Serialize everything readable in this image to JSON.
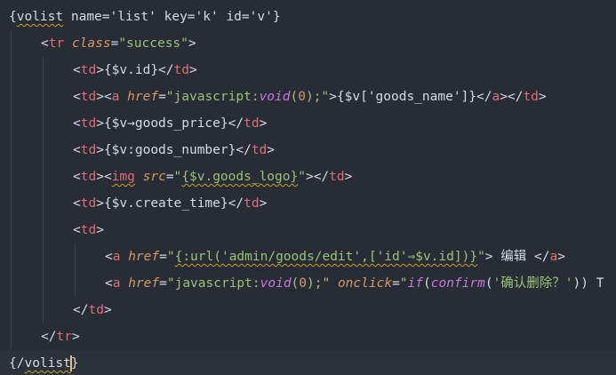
{
  "editor": {
    "colors": {
      "background": "#282c34",
      "current_line": "#2c313a",
      "tag": "#e06c75",
      "attribute": "#d19a66",
      "string": "#98c379",
      "function": "#c678dd",
      "text": "#d7dae0",
      "squiggle": "#c9a227"
    },
    "lines": [
      {
        "indent": 0,
        "tokens": [
          {
            "t": "{",
            "c": "punct"
          },
          {
            "t": "volist",
            "c": "text",
            "sq": true
          },
          {
            "t": " name='list' key='k' id='v'}",
            "c": "text"
          }
        ]
      },
      {
        "indent": 1,
        "tokens": [
          {
            "t": "<",
            "c": "punct"
          },
          {
            "t": "tr",
            "c": "tag"
          },
          {
            "t": " ",
            "c": "text"
          },
          {
            "t": "class",
            "c": "attr"
          },
          {
            "t": "=",
            "c": "punct"
          },
          {
            "t": "\"success\"",
            "c": "string"
          },
          {
            "t": ">",
            "c": "punct"
          }
        ]
      },
      {
        "indent": 2,
        "tokens": [
          {
            "t": "<",
            "c": "punct"
          },
          {
            "t": "td",
            "c": "tag"
          },
          {
            "t": ">",
            "c": "punct"
          },
          {
            "t": "{$v.id}",
            "c": "text"
          },
          {
            "t": "</",
            "c": "punct"
          },
          {
            "t": "td",
            "c": "tag"
          },
          {
            "t": ">",
            "c": "punct"
          }
        ]
      },
      {
        "indent": 2,
        "tokens": [
          {
            "t": "<",
            "c": "punct"
          },
          {
            "t": "td",
            "c": "tag"
          },
          {
            "t": ">",
            "c": "punct"
          },
          {
            "t": "<",
            "c": "punct"
          },
          {
            "t": "a",
            "c": "tag"
          },
          {
            "t": " ",
            "c": "text"
          },
          {
            "t": "href",
            "c": "attr"
          },
          {
            "t": "=",
            "c": "punct"
          },
          {
            "t": "\"javascript:",
            "c": "string"
          },
          {
            "t": "void",
            "c": "func"
          },
          {
            "t": "(",
            "c": "string"
          },
          {
            "t": "0",
            "c": "num"
          },
          {
            "t": ");\"",
            "c": "string"
          },
          {
            "t": ">",
            "c": "punct"
          },
          {
            "t": "{$v['goods_name']}",
            "c": "text"
          },
          {
            "t": "</",
            "c": "punct"
          },
          {
            "t": "a",
            "c": "tag"
          },
          {
            "t": ">",
            "c": "punct"
          },
          {
            "t": "</",
            "c": "punct"
          },
          {
            "t": "td",
            "c": "tag"
          },
          {
            "t": ">",
            "c": "punct"
          }
        ]
      },
      {
        "indent": 2,
        "tokens": [
          {
            "t": "<",
            "c": "punct"
          },
          {
            "t": "td",
            "c": "tag"
          },
          {
            "t": ">",
            "c": "punct"
          },
          {
            "t": "{$v→goods_price}",
            "c": "text"
          },
          {
            "t": "</",
            "c": "punct"
          },
          {
            "t": "td",
            "c": "tag"
          },
          {
            "t": ">",
            "c": "punct"
          }
        ]
      },
      {
        "indent": 2,
        "tokens": [
          {
            "t": "<",
            "c": "punct"
          },
          {
            "t": "td",
            "c": "tag"
          },
          {
            "t": ">",
            "c": "punct"
          },
          {
            "t": "{$v:goods_number}",
            "c": "text"
          },
          {
            "t": "</",
            "c": "punct"
          },
          {
            "t": "td",
            "c": "tag"
          },
          {
            "t": ">",
            "c": "punct"
          }
        ]
      },
      {
        "indent": 2,
        "tokens": [
          {
            "t": "<",
            "c": "punct"
          },
          {
            "t": "td",
            "c": "tag"
          },
          {
            "t": ">",
            "c": "punct"
          },
          {
            "t": "<",
            "c": "punct"
          },
          {
            "t": "img",
            "c": "tag",
            "sq": true
          },
          {
            "t": " ",
            "c": "text"
          },
          {
            "t": "src",
            "c": "attr"
          },
          {
            "t": "=",
            "c": "punct"
          },
          {
            "t": "\"",
            "c": "string"
          },
          {
            "t": "{$v.goods_logo}",
            "c": "string",
            "sq": true
          },
          {
            "t": "\"",
            "c": "string"
          },
          {
            "t": ">",
            "c": "punct"
          },
          {
            "t": "</",
            "c": "punct"
          },
          {
            "t": "td",
            "c": "tag"
          },
          {
            "t": ">",
            "c": "punct"
          }
        ]
      },
      {
        "indent": 2,
        "tokens": [
          {
            "t": "<",
            "c": "punct"
          },
          {
            "t": "td",
            "c": "tag"
          },
          {
            "t": ">",
            "c": "punct"
          },
          {
            "t": "{$v.create_time}",
            "c": "text"
          },
          {
            "t": "</",
            "c": "punct"
          },
          {
            "t": "td",
            "c": "tag"
          },
          {
            "t": ">",
            "c": "punct"
          }
        ]
      },
      {
        "indent": 2,
        "tokens": [
          {
            "t": "<",
            "c": "punct"
          },
          {
            "t": "td",
            "c": "tag"
          },
          {
            "t": ">",
            "c": "punct"
          }
        ]
      },
      {
        "indent": 3,
        "tokens": [
          {
            "t": "<",
            "c": "punct"
          },
          {
            "t": "a",
            "c": "tag"
          },
          {
            "t": " ",
            "c": "text"
          },
          {
            "t": "href",
            "c": "attr"
          },
          {
            "t": "=",
            "c": "punct"
          },
          {
            "t": "\"",
            "c": "string"
          },
          {
            "t": "{:url('admin/goods/edit',['id'⇒$v.id])}",
            "c": "string",
            "sq": true
          },
          {
            "t": "\"",
            "c": "string"
          },
          {
            "t": ">",
            "c": "punct"
          },
          {
            "t": " 编辑 ",
            "c": "text"
          },
          {
            "t": "</",
            "c": "punct"
          },
          {
            "t": "a",
            "c": "tag"
          },
          {
            "t": ">",
            "c": "punct"
          }
        ]
      },
      {
        "indent": 3,
        "tokens": [
          {
            "t": "<",
            "c": "punct"
          },
          {
            "t": "a",
            "c": "tag"
          },
          {
            "t": " ",
            "c": "text"
          },
          {
            "t": "href",
            "c": "attr"
          },
          {
            "t": "=",
            "c": "punct"
          },
          {
            "t": "\"javascript:",
            "c": "string"
          },
          {
            "t": "void",
            "c": "func"
          },
          {
            "t": "(",
            "c": "string"
          },
          {
            "t": "0",
            "c": "num"
          },
          {
            "t": ");\"",
            "c": "string"
          },
          {
            "t": " ",
            "c": "text"
          },
          {
            "t": "onclick",
            "c": "attr"
          },
          {
            "t": "=",
            "c": "punct"
          },
          {
            "t": "\"",
            "c": "string"
          },
          {
            "t": "if",
            "c": "func"
          },
          {
            "t": "(",
            "c": "punct"
          },
          {
            "t": "confirm",
            "c": "func"
          },
          {
            "t": "(",
            "c": "punct"
          },
          {
            "t": "'确认删除？'",
            "c": "string"
          },
          {
            "t": ")) T",
            "c": "text"
          }
        ]
      },
      {
        "indent": 2,
        "tokens": [
          {
            "t": "</",
            "c": "punct"
          },
          {
            "t": "td",
            "c": "tag"
          },
          {
            "t": ">",
            "c": "punct"
          }
        ]
      },
      {
        "indent": 1,
        "tokens": [
          {
            "t": "</",
            "c": "punct"
          },
          {
            "t": "tr",
            "c": "tag"
          },
          {
            "t": ">",
            "c": "punct"
          }
        ]
      },
      {
        "indent": 0,
        "current": true,
        "tokens": [
          {
            "t": "{/",
            "c": "punct"
          },
          {
            "t": "volist",
            "c": "text",
            "sq": true
          },
          {
            "t": "|",
            "c": "caret"
          },
          {
            "t": "}",
            "c": "punct"
          }
        ]
      }
    ]
  }
}
